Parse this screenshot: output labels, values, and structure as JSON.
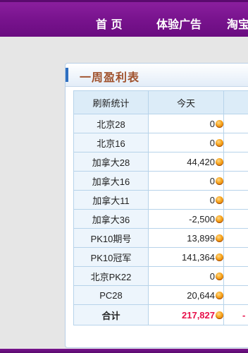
{
  "nav": {
    "items": [
      "首 页",
      "体验广告",
      "淘宝"
    ]
  },
  "panel": {
    "title": "一周盈利表"
  },
  "table": {
    "headers": [
      "刷新统计",
      "今天"
    ],
    "rows": [
      {
        "name": "北京28",
        "today": "0"
      },
      {
        "name": "北京16",
        "today": "0"
      },
      {
        "name": "加拿大28",
        "today": "44,420"
      },
      {
        "name": "加拿大16",
        "today": "0"
      },
      {
        "name": "加拿大11",
        "today": "0"
      },
      {
        "name": "加拿大36",
        "today": "-2,500"
      },
      {
        "name": "PK10期号",
        "today": "13,899"
      },
      {
        "name": "PK10冠军",
        "today": "141,364"
      },
      {
        "name": "北京PK22",
        "today": "0"
      },
      {
        "name": "PC28",
        "today": "20,644"
      }
    ],
    "total": {
      "label": "合计",
      "today": "217,827",
      "next_partial": "-"
    }
  },
  "colors": {
    "nav_bg": "#7a148f",
    "title_color": "#a0522d",
    "total_color": "#e8104a",
    "header_bg": "#dcecf8"
  },
  "icons": {
    "coin": "gold-coin-icon"
  }
}
